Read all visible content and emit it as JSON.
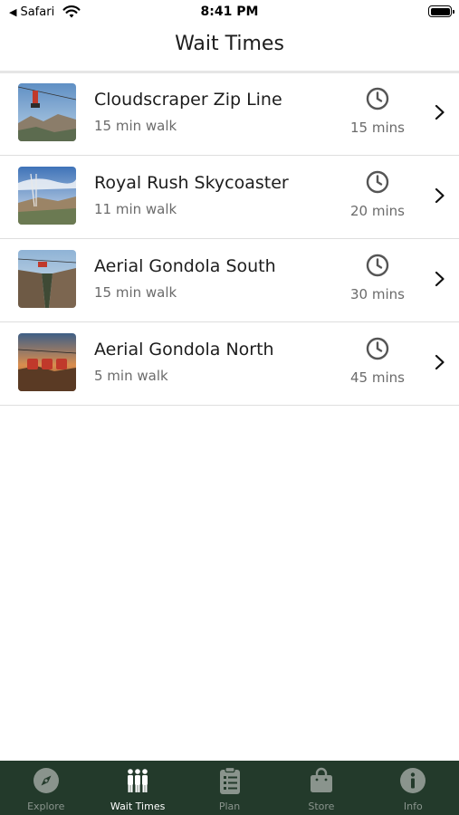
{
  "status_bar": {
    "back_app": "Safari",
    "time": "8:41 PM"
  },
  "nav": {
    "title": "Wait Times"
  },
  "rides": [
    {
      "name": "Cloudscraper Zip Line",
      "walk": "15 min walk",
      "wait": "15 mins"
    },
    {
      "name": "Royal Rush Skycoaster",
      "walk": "11 min walk",
      "wait": "20 mins"
    },
    {
      "name": "Aerial Gondola South",
      "walk": "15 min walk",
      "wait": "30 mins"
    },
    {
      "name": "Aerial Gondola North",
      "walk": "5 min walk",
      "wait": "45 mins"
    }
  ],
  "tabs": [
    {
      "label": "Explore",
      "icon": "compass-icon"
    },
    {
      "label": "Wait Times",
      "icon": "people-icon"
    },
    {
      "label": "Plan",
      "icon": "clipboard-icon"
    },
    {
      "label": "Store",
      "icon": "shopping-bag-icon"
    },
    {
      "label": "Info",
      "icon": "info-icon"
    }
  ],
  "colors": {
    "tabbar_bg": "#233a2b",
    "tab_active": "#ffffff",
    "tab_inactive": "#8a948d"
  }
}
